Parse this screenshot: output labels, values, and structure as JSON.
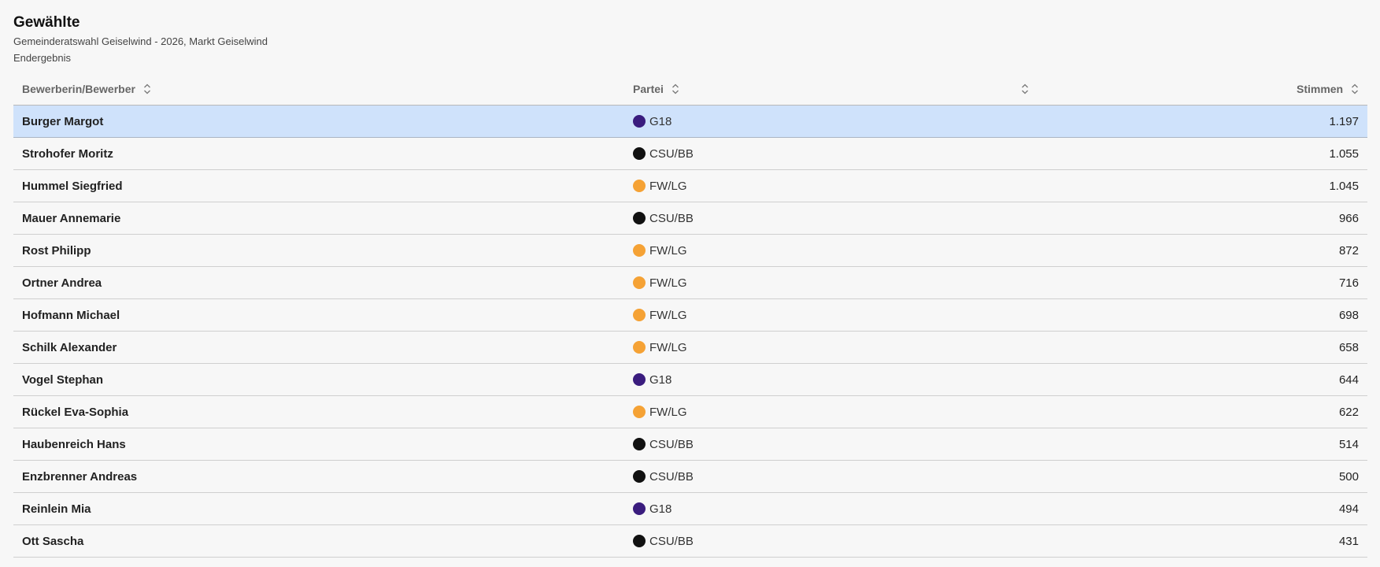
{
  "header": {
    "title": "Gewählte",
    "subtitle": "Gemeinderatswahl Geiselwind - 2026, Markt Geiselwind",
    "status": "Endergebnis"
  },
  "table": {
    "columns": {
      "candidate": "Bewerberin/Bewerber",
      "party": "Partei",
      "extra": "",
      "votes": "Stimmen"
    },
    "icons": {
      "sort": "sort-updown-icon"
    },
    "party_colors": {
      "G18": "#3a1c7e",
      "CSU/BB": "#111111",
      "FW/LG": "#f5a235"
    },
    "selected_row_color": "#cfe2fb",
    "rows": [
      {
        "name": "Burger Margot",
        "party": "G18",
        "votes": "1.197"
      },
      {
        "name": "Strohofer Moritz",
        "party": "CSU/BB",
        "votes": "1.055"
      },
      {
        "name": "Hummel Siegfried",
        "party": "FW/LG",
        "votes": "1.045"
      },
      {
        "name": "Mauer Annemarie",
        "party": "CSU/BB",
        "votes": "966"
      },
      {
        "name": "Rost Philipp",
        "party": "FW/LG",
        "votes": "872"
      },
      {
        "name": "Ortner Andrea",
        "party": "FW/LG",
        "votes": "716"
      },
      {
        "name": "Hofmann Michael",
        "party": "FW/LG",
        "votes": "698"
      },
      {
        "name": "Schilk Alexander",
        "party": "FW/LG",
        "votes": "658"
      },
      {
        "name": "Vogel Stephan",
        "party": "G18",
        "votes": "644"
      },
      {
        "name": "Rückel Eva-Sophia",
        "party": "FW/LG",
        "votes": "622"
      },
      {
        "name": "Haubenreich Hans",
        "party": "CSU/BB",
        "votes": "514"
      },
      {
        "name": "Enzbrenner Andreas",
        "party": "CSU/BB",
        "votes": "500"
      },
      {
        "name": "Reinlein Mia",
        "party": "G18",
        "votes": "494"
      },
      {
        "name": "Ott Sascha",
        "party": "CSU/BB",
        "votes": "431"
      }
    ]
  }
}
